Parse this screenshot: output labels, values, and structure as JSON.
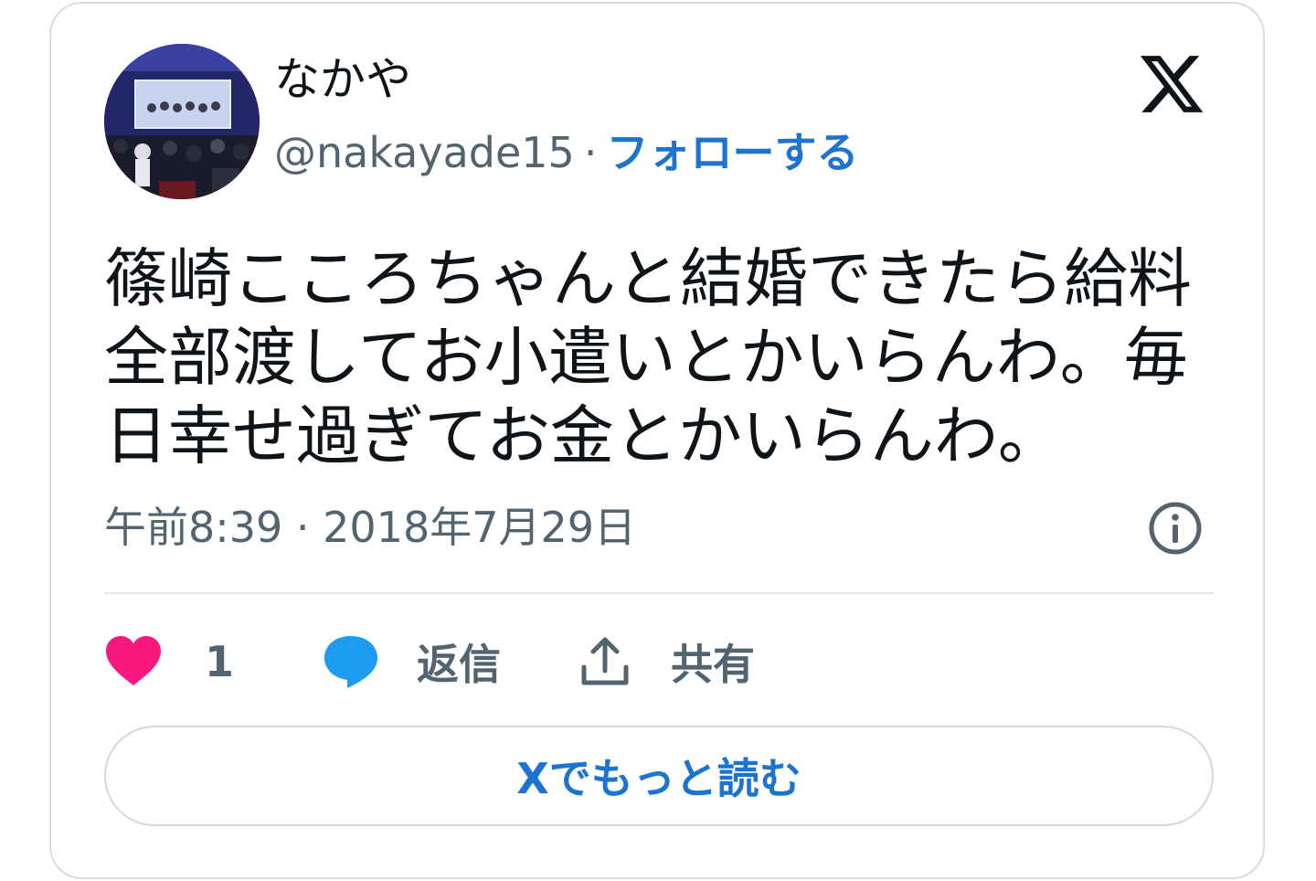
{
  "author": {
    "display_name": "なかや",
    "handle": "@nakayade15",
    "separator": "·",
    "follow_label": "フォローする"
  },
  "tweet": {
    "text": "篠崎こころちゃんと結婚できたら給料全部渡してお小遣いとかいらんわ。毎日幸せ過ぎてお金とかいらんわ。",
    "timestamp": "午前8:39 · 2018年7月29日"
  },
  "actions": {
    "like_count": "1",
    "reply_label": "返信",
    "share_label": "共有"
  },
  "read_more_label": "Xでもっと読む",
  "colors": {
    "link_blue": "#1d74d0",
    "like_pink": "#f91880",
    "reply_blue": "#1d9bf0",
    "secondary_text": "#536471"
  },
  "icons": {
    "x_logo": "x-logo-icon",
    "info": "info-icon",
    "like": "heart-icon",
    "reply": "speech-bubble-icon",
    "share": "share-upload-icon"
  }
}
